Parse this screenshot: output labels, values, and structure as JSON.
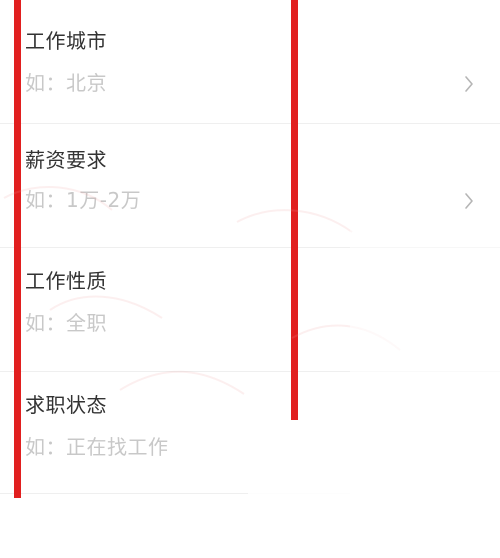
{
  "form": {
    "rows": [
      {
        "label": "工作城市",
        "placeholder": "如：北京",
        "has_chevron": true
      },
      {
        "label": "薪资要求",
        "placeholder": "如：1万-2万",
        "has_chevron": true
      },
      {
        "label": "工作性质",
        "placeholder": "如：全职",
        "has_chevron": false
      },
      {
        "label": "求职状态",
        "placeholder": "如：正在找工作",
        "has_chevron": false
      }
    ]
  },
  "icons": {
    "chevron": "chevron-right-icon"
  },
  "colors": {
    "label": "#333333",
    "placeholder": "#c8c8c8",
    "divider": "#efefef",
    "annotation_red": "#e11f1f"
  }
}
